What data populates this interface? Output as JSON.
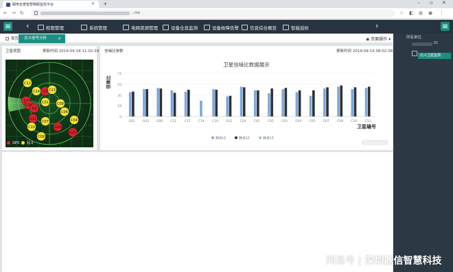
{
  "browser": {
    "tab_title": "邮电全景智慧物联监控平台",
    "url_text": "...me"
  },
  "header": {
    "nav_items": [
      {
        "label": "权限管理"
      },
      {
        "label": "系统管理"
      },
      {
        "label": "电网资源管理"
      },
      {
        "label": "设备全息监测"
      },
      {
        "label": "设备故障告警"
      },
      {
        "label": "信息综合概览"
      },
      {
        "label": "智能巡检"
      }
    ]
  },
  "sidebar": {
    "title": "所有单位",
    "node_suffix": "01",
    "selected_item": "北斗卫星监测"
  },
  "tabs": {
    "home": "首页",
    "active": "北斗信号分析",
    "page_ops": "页面操作"
  },
  "left_panel": {
    "title": "卫星视图",
    "time_label": "更新时间",
    "time": "2019-09-18 11:02:39",
    "legend": [
      {
        "label": "GPS",
        "color": "#d8262b"
      },
      {
        "label": "北斗",
        "color": "#f2e33a"
      }
    ],
    "satellites": [
      {
        "label": "C12",
        "kind": "bd"
      },
      {
        "label": "C14",
        "kind": "bd"
      },
      {
        "label": "G3",
        "kind": "gps"
      },
      {
        "label": "C13",
        "kind": "bd"
      },
      {
        "label": "C4",
        "kind": "gps"
      },
      {
        "label": "C16",
        "kind": "gps"
      },
      {
        "label": "G5",
        "kind": "gps"
      },
      {
        "label": "C01",
        "kind": "bd"
      },
      {
        "label": "C08",
        "kind": "bd"
      },
      {
        "label": "C06",
        "kind": "bd"
      },
      {
        "label": "G21",
        "kind": "gps"
      },
      {
        "label": "C10",
        "kind": "bd"
      },
      {
        "label": "C07",
        "kind": "bd"
      },
      {
        "label": "G29",
        "kind": "gps"
      },
      {
        "label": "C04",
        "kind": "bd"
      },
      {
        "label": "C09",
        "kind": "bd"
      },
      {
        "label": "G25",
        "kind": "gps"
      }
    ]
  },
  "right_panel": {
    "title": "信噪比参数",
    "time_label": "更新时间",
    "time": "2019-09-19 08:02:38"
  },
  "watermark": {
    "brand": "网易号",
    "sep": "|",
    "company": "深圳鼎信智慧科技"
  },
  "colors": {
    "header_bg": "#27333e",
    "accent": "#1d8f82",
    "series1": "#7ea8d6",
    "series2": "#2c3138",
    "series3": "#8fd79a"
  },
  "chart_data": {
    "type": "bar",
    "title": "卫星信噪比数据展示",
    "xlabel": "卫星编号",
    "ylabel": "信噪比",
    "ylim": [
      0,
      71
    ],
    "yticks": [
      0,
      18,
      35,
      53,
      71
    ],
    "grid": true,
    "legend_position": "bottom",
    "categories": [
      "G01",
      "G03",
      "G06",
      "C11",
      "C17",
      "C14",
      "C19",
      "G22",
      "C24",
      "C01",
      "C02",
      "C03",
      "C04",
      "C05",
      "C07",
      "C09",
      "C10",
      "C11"
    ],
    "series": [
      {
        "name": "频点L1",
        "color": "#7ea8d6",
        "values": [
          40,
          45,
          47,
          43,
          41,
          26,
          45,
          33,
          49,
          43,
          38,
          45,
          40,
          34,
          46,
          49,
          45,
          47
        ]
      },
      {
        "name": "频点L2",
        "color": "#2c3138",
        "values": [
          41,
          45,
          46,
          39,
          44,
          null,
          44,
          34,
          48,
          43,
          46,
          47,
          43,
          43,
          48,
          51,
          48,
          49
        ]
      },
      {
        "name": "频点L3",
        "color": "#8fd79a",
        "values": [
          null,
          null,
          null,
          null,
          null,
          null,
          null,
          null,
          null,
          null,
          null,
          null,
          null,
          null,
          null,
          null,
          null,
          null
        ]
      }
    ]
  }
}
